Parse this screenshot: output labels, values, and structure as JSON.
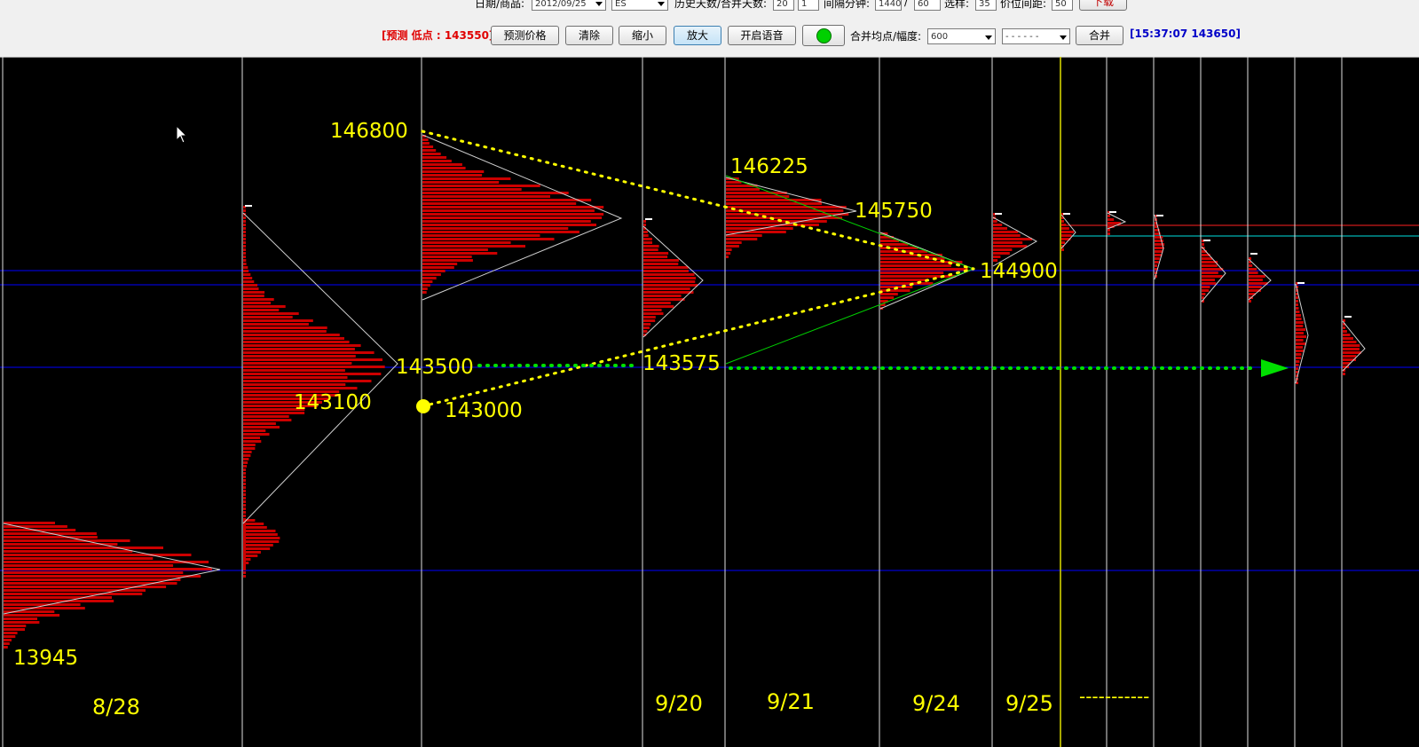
{
  "toolbar": {
    "date_label": "日期/商品:",
    "date_value": "2012/09/25",
    "symbol_value": "ES",
    "history_label": "历史天数/合并天数:",
    "history_days": "20",
    "merge_days": "1",
    "interval_label": "间隔分钟:",
    "interval_a": "1440",
    "interval_sep": "/",
    "interval_b": "60",
    "pick_label": "选样:",
    "pick_value": "35",
    "spacing_label": "价位间距:",
    "spacing_value": "50",
    "download_label": "下载",
    "forecast_text": "[预测 低点 : 143550]",
    "forecast_button": "预测价格",
    "clear_button": "清除",
    "zoom_out_button": "缩小",
    "zoom_in_button": "放大",
    "voice_button": "开启语音",
    "merge_label": "合并均点/幅度:",
    "merge_value": "600",
    "line_style_value": "- - - - - -",
    "merge_button": "合并",
    "status_text": "[15:37:07 143650]",
    "status_color": "#00c000"
  },
  "chart_data": {
    "type": "market-profile",
    "dates": [
      "8/28",
      "9/20",
      "9/21",
      "9/24",
      "9/25",
      "-----------"
    ],
    "price_labels": [
      "146800",
      "146225",
      "145750",
      "144900",
      "143500",
      "143575",
      "143100",
      "143000",
      "13945"
    ],
    "key_levels": [
      146800,
      146225,
      145750,
      144900,
      143575,
      143500,
      143100,
      143000
    ],
    "forecast_low": 143550,
    "last_price": 143650,
    "colors": {
      "profile": "#cc0000",
      "labels": "#ffff00",
      "trend": "#ffff00",
      "target": "#00e000",
      "levels": "#0000ff"
    }
  }
}
